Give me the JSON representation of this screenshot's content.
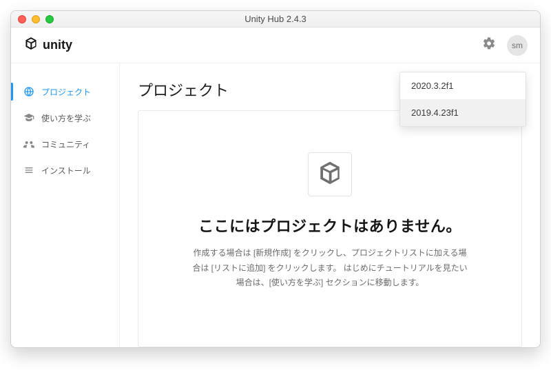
{
  "window": {
    "title": "Unity Hub 2.4.3"
  },
  "toolbar": {
    "brand": "unity",
    "avatar_initials": "sm"
  },
  "sidebar": {
    "items": [
      {
        "label": "プロジェクト",
        "active": true
      },
      {
        "label": "使い方を学ぶ",
        "active": false
      },
      {
        "label": "コミュニティ",
        "active": false
      },
      {
        "label": "インストール",
        "active": false
      }
    ]
  },
  "main": {
    "title": "プロジェクト",
    "empty_title": "ここにはプロジェクトはありません。",
    "empty_desc": "作成する場合は [新規作成] をクリックし、プロジェクトリストに加える場合は [リストに追加] をクリックします。 はじめにチュートリアルを見たい場合は、[使い方を学ぶ] セクションに移動します。"
  },
  "dropdown": {
    "options": [
      {
        "label": "2020.3.2f1",
        "highlight": false
      },
      {
        "label": "2019.4.23f1",
        "highlight": true
      }
    ]
  }
}
